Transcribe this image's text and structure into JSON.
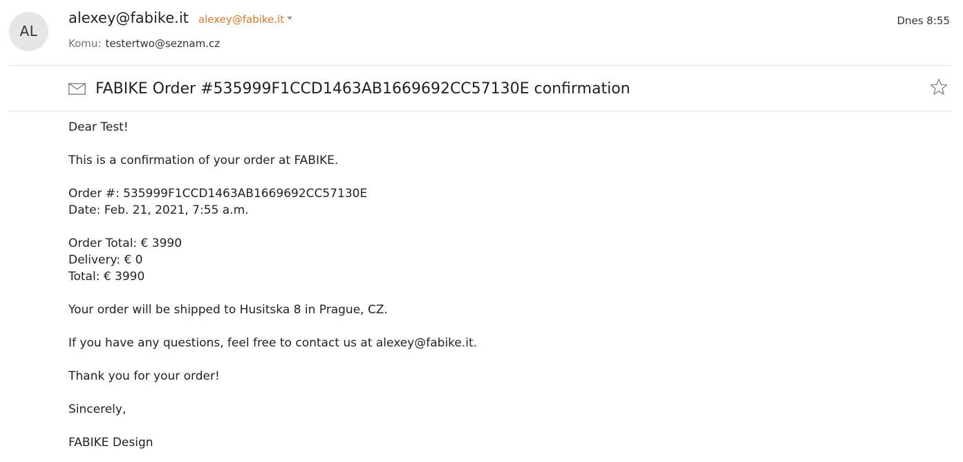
{
  "header": {
    "avatar_initials": "AL",
    "sender_name": "alexey@fabike.it",
    "sender_email": "alexey@fabike.it",
    "to_label": "Komu:",
    "to_value": "testertwo@seznam.cz",
    "date": "Dnes 8:55"
  },
  "subject": "FABIKE Order #535999F1CCD1463AB1669692CC57130E confirmation",
  "icons": {
    "envelope": "envelope-icon",
    "star": "star-icon",
    "caret": "chevron-down-icon"
  },
  "colors": {
    "accent": "#e0782c",
    "avatar_bg": "#e6e6e6",
    "divider": "#e3e3e3"
  },
  "body": {
    "greeting": "Dear Test!",
    "intro": "This is a confirmation of your order at FABIKE.",
    "order_number": "Order #: 535999F1CCD1463AB1669692CC57130E",
    "order_date": "Date: Feb. 21, 2021, 7:55 a.m.",
    "order_total": "Order Total: € 3990",
    "delivery": "Delivery: € 0",
    "total": "Total: € 3990",
    "shipping": "Your order will be shipped to Husitska 8 in Prague, CZ.",
    "questions": "If you have any questions, feel free to contact us at alexey@fabike.it.",
    "thanks": "Thank you for your order!",
    "closing": "Sincerely,",
    "signature": "FABIKE Design"
  }
}
